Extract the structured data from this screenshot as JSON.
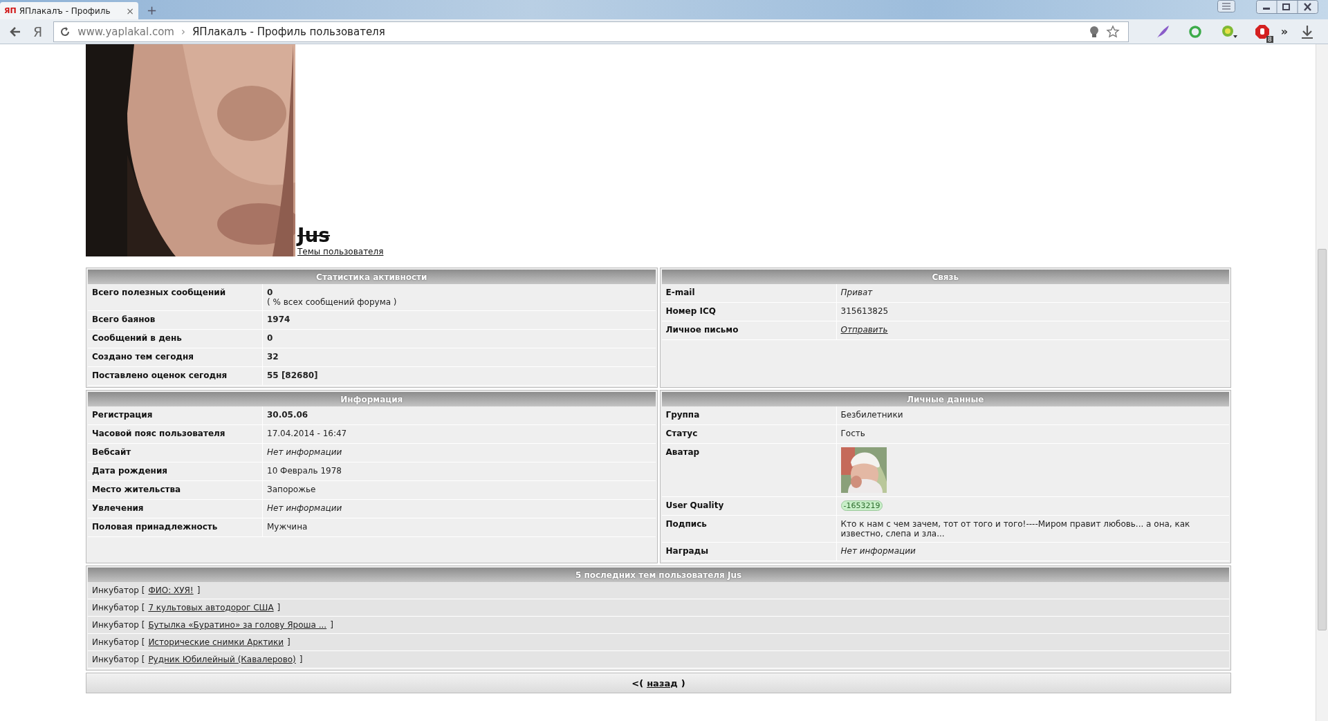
{
  "browser": {
    "tab": {
      "favicon_text": "ЯП",
      "title": "ЯПлакалъ - Профиль",
      "close": "×",
      "selected": true
    },
    "new_tab": "+",
    "home_button": "Я",
    "address": {
      "domain": "www.yaplakal.com",
      "separator": "›",
      "page_title": "ЯПлакалъ - Профиль пользователя"
    },
    "extensions_more": "»",
    "extension_badge": "8"
  },
  "profile": {
    "name": "Jus",
    "struck": true,
    "topics_link": "Темы пользователя"
  },
  "panels": [
    {
      "title": "Статистика активности",
      "rows": [
        {
          "label": "Всего полезных сообщений",
          "value": "0",
          "kind": "bold",
          "note": "( % всех сообщений форума )"
        },
        {
          "label": "Всего баянов",
          "value": "1974",
          "kind": "bold"
        },
        {
          "label": "Сообщений в день",
          "value": "0",
          "kind": "bold"
        },
        {
          "label": "Создано тем сегодня",
          "value": "32",
          "kind": "bold"
        },
        {
          "label": "Поставлено оценок сегодня",
          "value": "55 [82680]",
          "kind": "bold"
        }
      ]
    },
    {
      "title": "Связь",
      "rows": [
        {
          "label": "E-mail",
          "value": "Приват",
          "kind": "italic"
        },
        {
          "label": "Номер ICQ",
          "value": "315613825",
          "kind": "plain"
        },
        {
          "label": "Личное письмо",
          "value": "Отправить",
          "kind": "link"
        }
      ]
    },
    {
      "title": "Информация",
      "rows": [
        {
          "label": "Регистрация",
          "value": "30.05.06",
          "kind": "bold"
        },
        {
          "label": "Часовой пояс пользователя",
          "value": "17.04.2014 - 16:47",
          "kind": "plain"
        },
        {
          "label": "Вебсайт",
          "value": "Нет информации",
          "kind": "italic"
        },
        {
          "label": "Дата рождения",
          "value": "10 Февраль 1978",
          "kind": "plain"
        },
        {
          "label": "Место жительства",
          "value": "Запорожье",
          "kind": "plain"
        },
        {
          "label": "Увлечения",
          "value": "Нет информации",
          "kind": "italic"
        },
        {
          "label": "Половая принадлежность",
          "value": "Мужчина",
          "kind": "plain"
        }
      ]
    },
    {
      "title": "Личные данные",
      "rows": [
        {
          "label": "Группа",
          "value": "Безбилетники",
          "kind": "plain"
        },
        {
          "label": "Статус",
          "value": "Гость",
          "kind": "plain"
        },
        {
          "label": "Аватар",
          "kind": "avatar"
        },
        {
          "label": "User Quality",
          "value": "-1653219",
          "kind": "badge"
        },
        {
          "label": "Подпись",
          "value": "Кто к нам с чем зачем, тот от того и того!----Миром правит любовь... а она, как известно, слепа и зла...",
          "kind": "plain"
        },
        {
          "label": "Награды",
          "value": "Нет информации",
          "kind": "italic"
        }
      ]
    }
  ],
  "recent_topics": {
    "title": "5 последних тем пользователя Jus",
    "items": [
      {
        "section": "Инкубатор [",
        "title": "ФИО: ХУЯ!",
        "close": "]"
      },
      {
        "section": "Инкубатор [",
        "title": "7 культовых автодорог США",
        "close": "]"
      },
      {
        "section": "Инкубатор [",
        "title": "Бутылка «Буратино» за голову Яроша ...",
        "close": "]"
      },
      {
        "section": "Инкубатор [",
        "title": "Исторические снимки Арктики",
        "close": "]"
      },
      {
        "section": "Инкубатор [",
        "title": "Рудник Юбилейный (Кавалерово)",
        "close": "]"
      }
    ]
  },
  "back": {
    "open": "<(",
    "link": "назад",
    "close": ")"
  }
}
